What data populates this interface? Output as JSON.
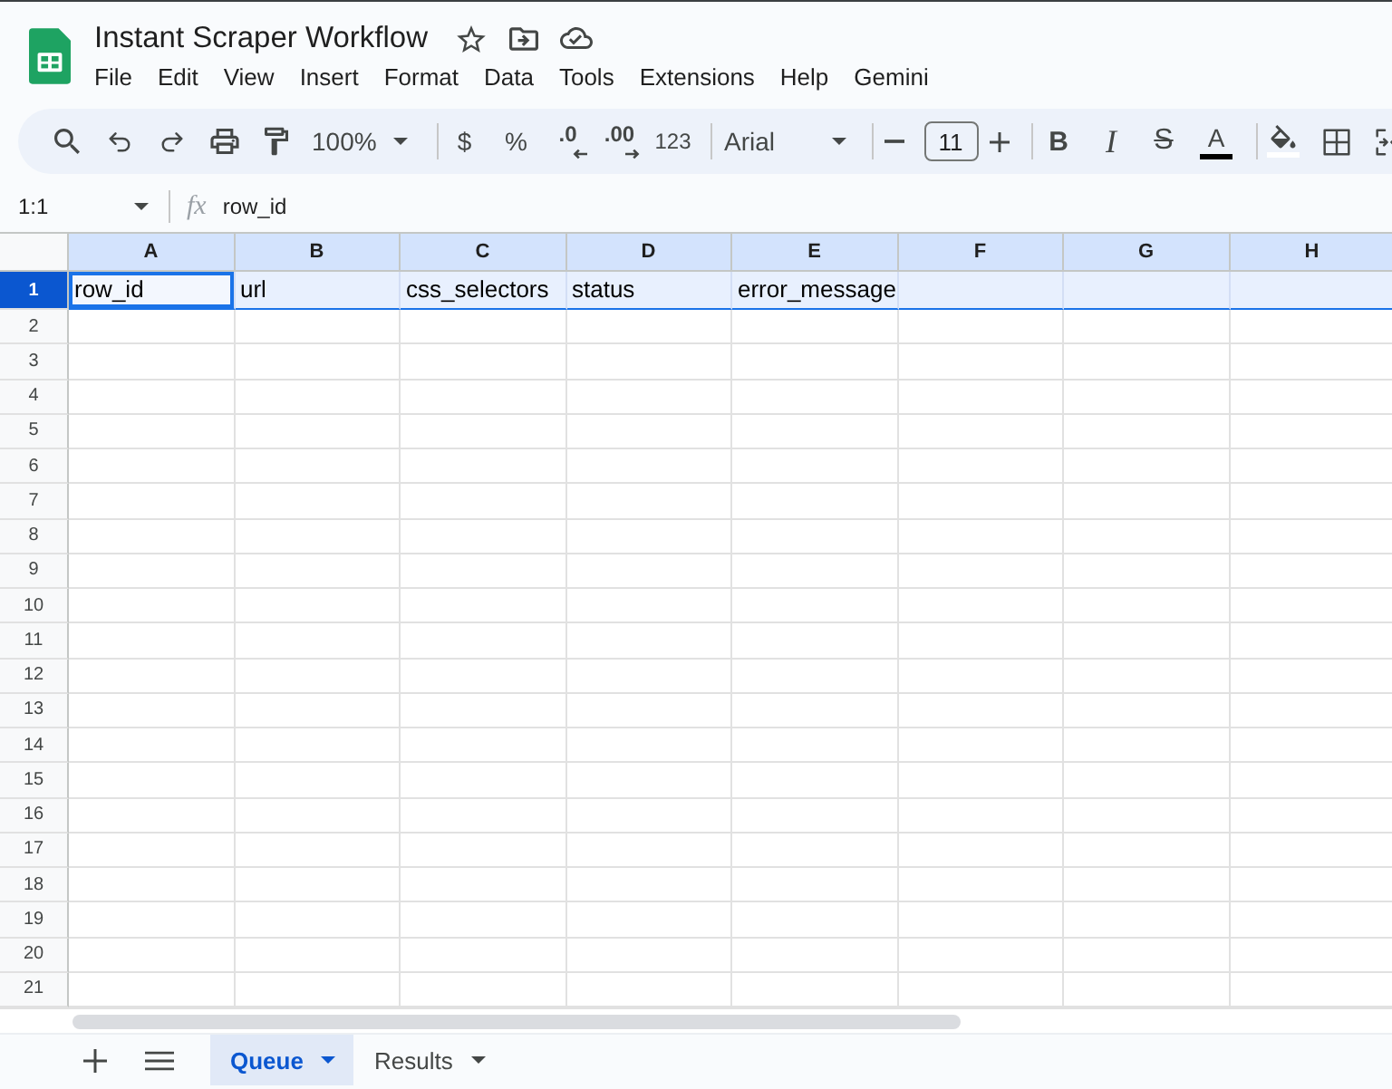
{
  "document": {
    "title": "Instant Scraper Workflow"
  },
  "menu": [
    "File",
    "Edit",
    "View",
    "Insert",
    "Format",
    "Data",
    "Tools",
    "Extensions",
    "Help",
    "Gemini"
  ],
  "toolbar": {
    "zoom": "100%",
    "currency": "$",
    "percent": "%",
    "decrease_decimal": ".0",
    "increase_decimal": ".00",
    "number_format": "123",
    "font": "Arial",
    "font_size": "11",
    "bold": "B",
    "italic": "I",
    "strikethrough": "S",
    "text_color": "A"
  },
  "formula_bar": {
    "cell_reference": "1:1",
    "function_label": "fx",
    "value": "row_id"
  },
  "sheet": {
    "columns": [
      {
        "label": "A",
        "highlighted": true
      },
      {
        "label": "B",
        "highlighted": true
      },
      {
        "label": "C",
        "highlighted": true
      },
      {
        "label": "D",
        "highlighted": true
      },
      {
        "label": "E",
        "highlighted": true
      },
      {
        "label": "F",
        "highlighted": true
      },
      {
        "label": "G",
        "highlighted": true
      },
      {
        "label": "H",
        "highlighted": true
      }
    ],
    "rows": [
      {
        "number": "1",
        "selected": true,
        "cells": [
          {
            "text": "row_id",
            "active": true
          },
          {
            "text": "url",
            "active": false
          },
          {
            "text": "css_selectors",
            "active": false
          },
          {
            "text": "status",
            "active": false
          },
          {
            "text": "error_message",
            "active": false
          }
        ]
      },
      {
        "number": "2",
        "selected": false
      },
      {
        "number": "3",
        "selected": false
      },
      {
        "number": "4",
        "selected": false
      },
      {
        "number": "5",
        "selected": false
      },
      {
        "number": "6",
        "selected": false
      },
      {
        "number": "7",
        "selected": false
      },
      {
        "number": "8",
        "selected": false
      },
      {
        "number": "9",
        "selected": false
      },
      {
        "number": "10",
        "selected": false
      },
      {
        "number": "11",
        "selected": false
      },
      {
        "number": "12",
        "selected": false
      },
      {
        "number": "13",
        "selected": false
      },
      {
        "number": "14",
        "selected": false
      },
      {
        "number": "15",
        "selected": false
      },
      {
        "number": "16",
        "selected": false
      },
      {
        "number": "17",
        "selected": false
      },
      {
        "number": "18",
        "selected": false
      },
      {
        "number": "19",
        "selected": false
      },
      {
        "number": "20",
        "selected": false
      },
      {
        "number": "21",
        "selected": false
      }
    ]
  },
  "sheet_tabs": [
    {
      "label": "Queue",
      "selected": true
    },
    {
      "label": "Results",
      "selected": false
    }
  ]
}
